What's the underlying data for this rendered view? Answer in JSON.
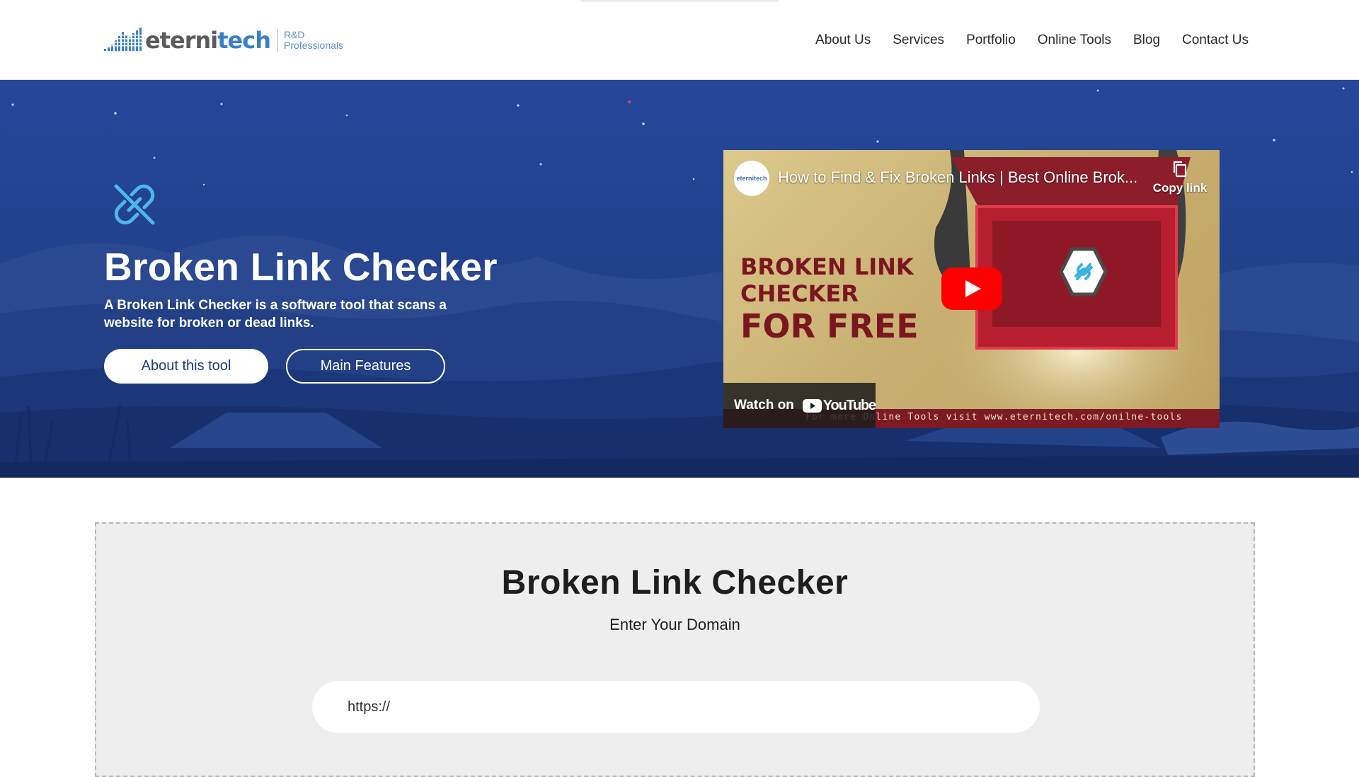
{
  "brand": {
    "name_part1": "eterni",
    "name_part2": "tech",
    "tagline_line1": "R&D",
    "tagline_line2": "Professionals"
  },
  "nav": {
    "items": [
      {
        "label": "About Us"
      },
      {
        "label": "Services"
      },
      {
        "label": "Portfolio"
      },
      {
        "label": "Online Tools"
      },
      {
        "label": "Blog"
      },
      {
        "label": "Contact Us"
      }
    ]
  },
  "hero": {
    "icon": "broken-link-icon",
    "title": "Broken Link Checker",
    "description": "A Broken Link Checker is a software tool that scans a website for broken or dead links.",
    "buttons": {
      "about": "About this tool",
      "features": "Main Features"
    }
  },
  "video": {
    "channel_avatar_text": "eternitech",
    "title": "How to Find & Fix Broken Links | Best Online Brok...",
    "copy_link": "Copy link",
    "thumbnail_line1": "BROKEN LINK",
    "thumbnail_line2": "CHECKER",
    "thumbnail_line3": "FOR FREE",
    "watch_on": "Watch on",
    "youtube_label": "YouTube",
    "footer_text": "For more Online Tools visit www.eternitech.com/onilne-tools"
  },
  "tool": {
    "title": "Broken Link Checker",
    "subtitle": "Enter Your Domain",
    "input_placeholder": "https://",
    "input_value": ""
  },
  "colors": {
    "hero_bg": "#21418d",
    "accent_link_icon": "#4fb6ea",
    "thumbnail_red": "#7a1620",
    "youtube_red": "#ff0000"
  }
}
